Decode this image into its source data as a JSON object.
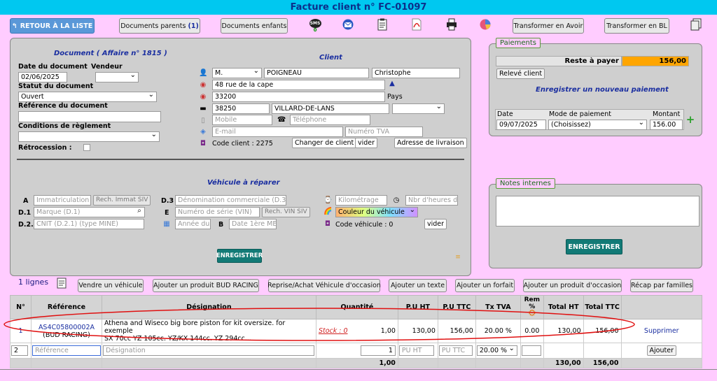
{
  "header": {
    "title": "Facture client n° FC-01097"
  },
  "toolbar": {
    "back_label": "RETOUR À LA LISTE",
    "parents_label": "Documents parents",
    "parents_count": "(1)",
    "children_label": "Documents enfants",
    "sms_label": "SMS",
    "sms_count": "0",
    "avoir_label": "Transformer en Avoir",
    "bl_label": "Transformer en BL"
  },
  "document": {
    "title": "Document ( Affaire n° 1815 )",
    "date_label": "Date du document",
    "vendeur_label": "Vendeur",
    "date_value": "02/06/2025",
    "vendeur_value": "",
    "statut_label": "Statut du document",
    "statut_value": "Ouvert",
    "ref_label": "Référence du document",
    "ref_value": "",
    "conditions_label": "Conditions de règlement",
    "conditions_value": "",
    "retro_label": "Rétrocession :"
  },
  "client": {
    "title": "Client",
    "civility": "M.",
    "lastname": "POIGNEAU",
    "firstname": "Christophe",
    "address1": "48 rue de la cape",
    "address2": "33200",
    "pays_label": "Pays",
    "zip": "38250",
    "city": "VILLARD-DE-LANS",
    "country": "",
    "mobile_placeholder": "Mobile",
    "phone_placeholder": "Téléphone",
    "email_placeholder": "E-mail",
    "tva_placeholder": "Numéro TVA",
    "code_label": "Code client : 2275",
    "change_label": "Changer de client",
    "vider_label": "vider",
    "livraison_label": "Adresse de livraison"
  },
  "vehicle": {
    "title": "Véhicule à réparer",
    "a_label": "A",
    "immat_placeholder": "Immatriculation",
    "rech_immat_label": "Rech. Immat SIV",
    "d3_label": "D.3",
    "denom_placeholder": "Dénomination commerciale (D.3)",
    "km_placeholder": "Kilométrage",
    "heures_placeholder": "Nbr d'heures de",
    "d1_label": "D.1",
    "marque_placeholder": "Marque (D.1)",
    "e_label": "E",
    "vin_placeholder": "Numéro de série (VIN)",
    "rech_vin_label": "Rech. VIN SIV",
    "couleur_value": "Couleur du véhicule",
    "d21_label": "D.2.1",
    "cnit_placeholder": "CNIT (D.2.1) (type MINE)",
    "annee_placeholder": "Année du",
    "b_label": "B",
    "date1_placeholder": "Date 1ère ME",
    "code_label": "Code véhicule : 0",
    "vider_label": "vider",
    "save_label": "ENREGISTRER"
  },
  "payments": {
    "legend": "Paiements",
    "reste_label": "Reste à payer",
    "reste_value": "156,00",
    "releve_label": "Relevé client",
    "new_label": "Enregistrer un nouveau paiement",
    "date_label": "Date",
    "mode_label": "Mode de paiement",
    "montant_label": "Montant",
    "date_value": "09/07/2025",
    "mode_value": "(Choisissez)",
    "montant_value": "156.00"
  },
  "notes": {
    "legend": "Notes internes",
    "value": "",
    "save_label": "ENREGISTRER"
  },
  "lines_bar": {
    "count_label": "1 lignes",
    "buttons": [
      "Vendre un véhicule",
      "Ajouter un produit BUD RACING",
      "Reprise/Achat Véhicule d'occasion",
      "Ajouter un texte",
      "Ajouter un forfait",
      "Ajouter un produit d'occasion",
      "Récap par familles"
    ]
  },
  "table": {
    "headers": [
      "N°",
      "Référence",
      "Désignation",
      "Quantité",
      "P.U HT",
      "P.U TTC",
      "Tx TVA",
      "Rem %",
      "Total HT",
      "Total TTC"
    ],
    "row": {
      "num": "1",
      "ref": "AS4C05800002A",
      "ref_sub": "(BUD RACING)",
      "designation_1": "Athena and Wiseco big bore piston for kit oversize. for exemple",
      "designation_2": "SX 70cc YZ 105cc. YZ/KX 144cc. YZ 294cc...",
      "stock": "Stock : 0",
      "qty": "1,00",
      "pu_ht": "130,00",
      "pu_ttc": "156,00",
      "tva": "20.00 %",
      "rem": "0.00",
      "total_ht": "130,00",
      "total_ttc": "156,00",
      "delete_label": "Supprimer"
    },
    "new_row": {
      "num": "2",
      "ref_placeholder": "Référence",
      "desig_placeholder": "Désignation",
      "qty": "1",
      "pu_ht_placeholder": "PU HT",
      "pu_ttc_placeholder": "PU TTC",
      "tva": "20.00 %",
      "add_label": "Ajouter"
    },
    "totals": {
      "qty": "1,00",
      "total_ht": "130,00",
      "total_ttc": "156,00"
    }
  }
}
